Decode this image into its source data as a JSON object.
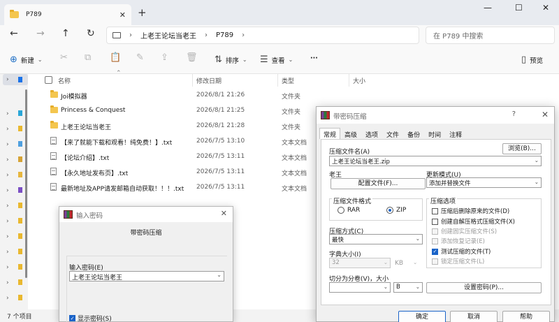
{
  "explorer": {
    "tab_title": "P789",
    "tab_close": "✕",
    "new_tab": "+",
    "window_controls": {
      "minimize": "—",
      "maximize": "☐",
      "close": "✕"
    },
    "nav": {
      "back": "←",
      "forward": "→",
      "up": "↑",
      "refresh": "↻"
    },
    "breadcrumb": [
      "上老王论坛当老王",
      "P789"
    ],
    "breadcrumb_sep": "›",
    "search_placeholder": "在 P789 中搜索",
    "toolbar": {
      "new_label": "新建",
      "sort_label": "排序",
      "view_label": "查看",
      "more_label": "···",
      "preview_label": "预览",
      "dropdown_glyph": "⌄"
    },
    "columns": {
      "name": "名称",
      "date": "修改日期",
      "type": "类型",
      "size": "大小"
    },
    "files": [
      {
        "icon": "folder",
        "name": "Joi模拟器",
        "date": "2026/8/1 21:26",
        "type": "文件夹"
      },
      {
        "icon": "folder",
        "name": "Princess & Conquest",
        "date": "2026/8/1 21:25",
        "type": "文件夹"
      },
      {
        "icon": "folder",
        "name": "上老王论坛当老王",
        "date": "2026/8/1 21:28",
        "type": "文件夹"
      },
      {
        "icon": "txt",
        "name": "【来了就能下载和观看！纯免费！】.txt",
        "date": "2026/7/5 13:10",
        "type": "文本文档"
      },
      {
        "icon": "txt",
        "name": "【论坛介绍】.txt",
        "date": "2026/7/5 13:11",
        "type": "文本文档"
      },
      {
        "icon": "txt",
        "name": "【永久地址发布页】.txt",
        "date": "2026/7/5 13:11",
        "type": "文本文档"
      },
      {
        "icon": "txt",
        "name": "最新地址及APP请发邮箱自动获取！！！.txt",
        "date": "2026/7/5 13:11",
        "type": "文本文档"
      }
    ],
    "status": "7 个项目"
  },
  "password_dialog": {
    "title": "输入密码",
    "close": "✕",
    "header": "带密码压缩",
    "input_label": "输入密码(E)",
    "input_value": "上老王论坛当老王",
    "dropdown_glyph": "⌄",
    "show_password_label": "显示密码(S)",
    "show_password_checked": true
  },
  "archive_dialog": {
    "title": "带密码压缩",
    "help_glyph": "?",
    "close": "✕",
    "tabs": [
      "常规",
      "高级",
      "选项",
      "文件",
      "备份",
      "时间",
      "注释"
    ],
    "active_tab": 0,
    "archive_name_label": "压缩文件名(A)",
    "browse_button": "浏览(B)...",
    "archive_name_value": "上老王论坛当老王.zip",
    "profile_label": "老王",
    "profiles_button": "配置文件(F)...",
    "update_mode_label": "更新模式(U)",
    "update_mode_value": "添加并替换文件",
    "format_label": "压缩文件格式",
    "format_options": [
      "RAR",
      "ZIP"
    ],
    "format_selected": "ZIP",
    "options_label": "压缩选项",
    "options": [
      {
        "label": "压缩后删除原来的文件(D)",
        "checked": false,
        "disabled": false
      },
      {
        "label": "创建自解压格式压缩文件(X)",
        "checked": false,
        "disabled": false
      },
      {
        "label": "创建固实压缩文件(S)",
        "checked": false,
        "disabled": true
      },
      {
        "label": "添加恢复记录(E)",
        "checked": false,
        "disabled": true
      },
      {
        "label": "测试压缩的文件(T)",
        "checked": true,
        "disabled": false
      },
      {
        "label": "锁定压缩文件(L)",
        "checked": false,
        "disabled": true
      }
    ],
    "method_label": "压缩方式(C)",
    "method_value": "最快",
    "dict_label": "字典大小(I)",
    "dict_value": "32",
    "dict_unit": "KB",
    "split_label": "切分为分卷(V)，大小",
    "split_value": "",
    "split_unit": "B",
    "set_password_button": "设置密码(P)...",
    "ok_button": "确定",
    "cancel_button": "取消",
    "help_button": "帮助",
    "dropdown_glyph": "⌄"
  }
}
